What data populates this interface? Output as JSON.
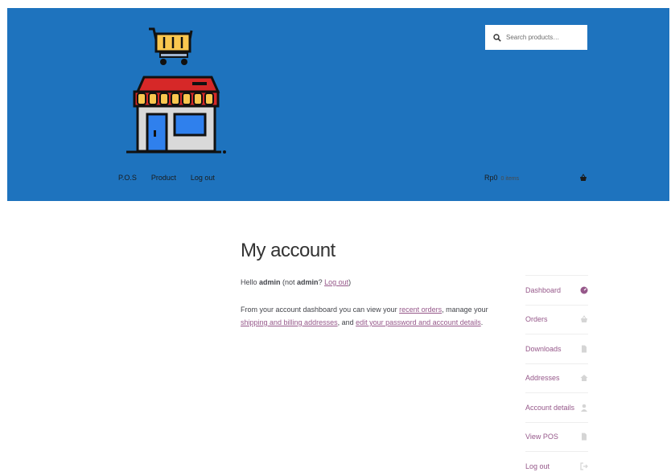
{
  "header": {
    "search": {
      "placeholder": "Search products…"
    },
    "nav": [
      {
        "label": "P.O.S"
      },
      {
        "label": "Product"
      },
      {
        "label": "Log out"
      }
    ],
    "cart": {
      "amount": "Rp0",
      "count": "0 items"
    },
    "colors": {
      "header_bg": "#1e73be"
    }
  },
  "main": {
    "title": "My account",
    "hello": {
      "prefix": "Hello ",
      "username": "admin",
      "middle": " (not ",
      "username2": "admin",
      "middle2": "? ",
      "logout_link": "Log out",
      "suffix": ")"
    },
    "description": {
      "part1": "From your account dashboard you can view your ",
      "link_orders": "recent orders",
      "part2": ", manage your ",
      "link_addresses": "shipping and billing addresses",
      "part3": ", and ",
      "link_account": "edit your password and account details",
      "part4": "."
    }
  },
  "account_nav": [
    {
      "label": "Dashboard",
      "icon": "dashboard-icon"
    },
    {
      "label": "Orders",
      "icon": "basket-icon"
    },
    {
      "label": "Downloads",
      "icon": "file-icon"
    },
    {
      "label": "Addresses",
      "icon": "home-icon"
    },
    {
      "label": "Account details",
      "icon": "user-icon"
    },
    {
      "label": "View POS",
      "icon": "file-icon"
    },
    {
      "label": "Log out",
      "icon": "sign-out-icon"
    }
  ]
}
